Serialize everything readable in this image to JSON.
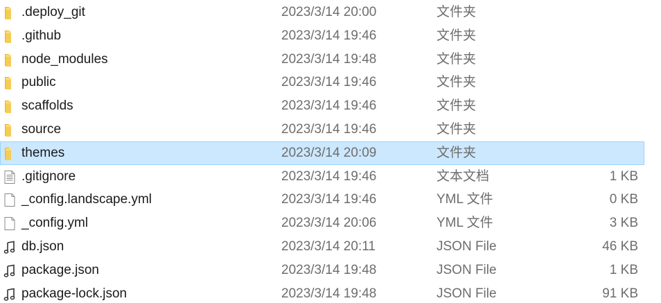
{
  "files": [
    {
      "name": ".deploy_git",
      "date": "2023/3/14 20:00",
      "type": "文件夹",
      "size": "",
      "icon": "folder-icon",
      "selected": false
    },
    {
      "name": ".github",
      "date": "2023/3/14 19:46",
      "type": "文件夹",
      "size": "",
      "icon": "folder-icon",
      "selected": false
    },
    {
      "name": "node_modules",
      "date": "2023/3/14 19:48",
      "type": "文件夹",
      "size": "",
      "icon": "folder-icon",
      "selected": false
    },
    {
      "name": "public",
      "date": "2023/3/14 19:46",
      "type": "文件夹",
      "size": "",
      "icon": "folder-icon",
      "selected": false
    },
    {
      "name": "scaffolds",
      "date": "2023/3/14 19:46",
      "type": "文件夹",
      "size": "",
      "icon": "folder-icon",
      "selected": false
    },
    {
      "name": "source",
      "date": "2023/3/14 19:46",
      "type": "文件夹",
      "size": "",
      "icon": "folder-icon",
      "selected": false
    },
    {
      "name": "themes",
      "date": "2023/3/14 20:09",
      "type": "文件夹",
      "size": "",
      "icon": "folder-icon",
      "selected": true
    },
    {
      "name": ".gitignore",
      "date": "2023/3/14 19:46",
      "type": "文本文档",
      "size": "1 KB",
      "icon": "text-document-icon",
      "selected": false
    },
    {
      "name": "_config.landscape.yml",
      "date": "2023/3/14 19:46",
      "type": "YML 文件",
      "size": "0 KB",
      "icon": "blank-file-icon",
      "selected": false
    },
    {
      "name": "_config.yml",
      "date": "2023/3/14 20:06",
      "type": "YML 文件",
      "size": "3 KB",
      "icon": "blank-file-icon",
      "selected": false
    },
    {
      "name": "db.json",
      "date": "2023/3/14 20:11",
      "type": "JSON File",
      "size": "46 KB",
      "icon": "json-file-icon",
      "selected": false
    },
    {
      "name": "package.json",
      "date": "2023/3/14 19:48",
      "type": "JSON File",
      "size": "1 KB",
      "icon": "json-file-icon",
      "selected": false
    },
    {
      "name": "package-lock.json",
      "date": "2023/3/14 19:48",
      "type": "JSON File",
      "size": "91 KB",
      "icon": "json-file-icon",
      "selected": false
    }
  ],
  "colors": {
    "folder": "#f0c44a",
    "selection": "#cce8ff",
    "selection_border": "#99d1ff"
  }
}
